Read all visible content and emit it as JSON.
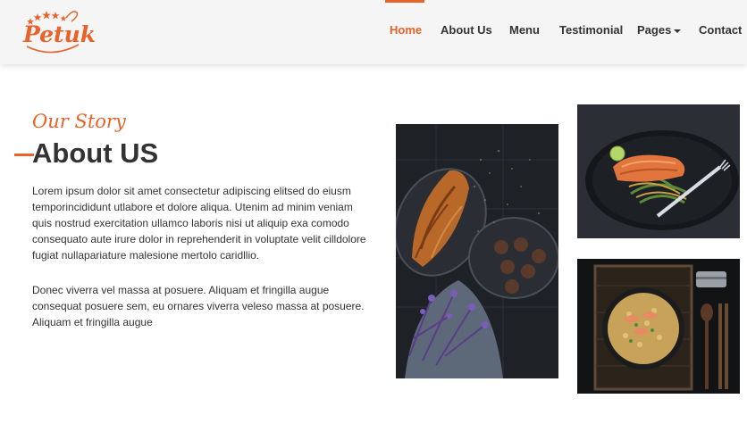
{
  "brand": {
    "name": "Petuk"
  },
  "nav": {
    "items": [
      {
        "label": "Home",
        "active": true
      },
      {
        "label": "About Us",
        "active": false
      },
      {
        "label": "Menu",
        "active": false
      },
      {
        "label": "Testimonial",
        "active": false
      },
      {
        "label": "Pages",
        "active": false,
        "dropdown": true
      },
      {
        "label": "Contact",
        "active": false
      }
    ]
  },
  "about": {
    "eyebrow": "Our Story",
    "title": "About US",
    "paragraph1": "Lorem ipsum dolor sit amet consectetur adipiscing elitsed do eiusm temporincididunt utlabore et dolore aliqua. Utenim ad minim veniam quis nostrud exercitation ullamco laboris nisi ut aliquip exa comodo consequato aute irure dolor in reprehenderit in voluptate velit cilldolore fugiat nullapariature malesione mertolo caridllio.",
    "paragraph2": "Donec viverra vel massa at posuere. Aliquam et fringilla augue consequat posuere sem, eu ornares viverra veleso massa at posuere. Aliquam et fringilla augue"
  },
  "images": [
    {
      "name": "croissant-photo"
    },
    {
      "name": "salmon-plate-photo"
    },
    {
      "name": "shrimp-rice-photo"
    }
  ],
  "colors": {
    "accent": "#e8622a",
    "text": "#333333",
    "header_bg": "#f5f5f5"
  }
}
